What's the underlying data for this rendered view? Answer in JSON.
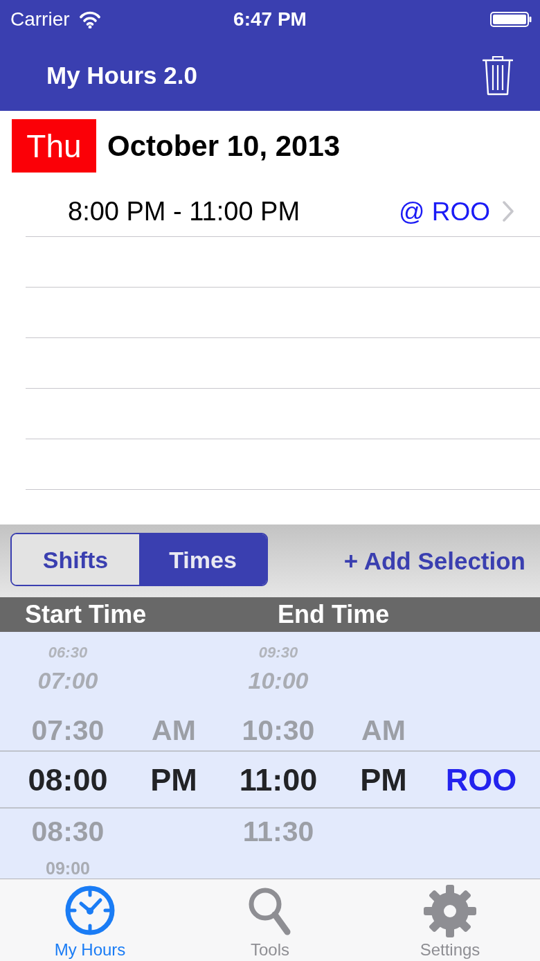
{
  "status_bar": {
    "carrier": "Carrier",
    "time": "6:47 PM"
  },
  "nav_bar": {
    "title": "My Hours 2.0"
  },
  "day": {
    "weekday": "Thu",
    "date": "October 10, 2013",
    "entries": [
      {
        "time": "8:00 PM - 11:00 PM",
        "location": "@ ROO"
      }
    ]
  },
  "toolbar": {
    "segments": [
      {
        "label": "Shifts",
        "selected": false
      },
      {
        "label": "Times",
        "selected": true
      }
    ],
    "add_button": "+ Add Selection"
  },
  "picker": {
    "headers": [
      "Start Time",
      "End Time"
    ],
    "columns": [
      {
        "kind": "time",
        "items": [
          {
            "label": "06:30",
            "selected": false
          },
          {
            "label": "07:00",
            "selected": false
          },
          {
            "label": "07:30",
            "selected": false
          },
          {
            "label": "08:00",
            "selected": true
          },
          {
            "label": "08:30",
            "selected": false
          },
          {
            "label": "09:00",
            "selected": false
          }
        ]
      },
      {
        "kind": "period",
        "items": [
          {
            "label": "AM",
            "selected": false
          },
          {
            "label": "PM",
            "selected": true
          }
        ]
      },
      {
        "kind": "time",
        "items": [
          {
            "label": "09:30",
            "selected": false
          },
          {
            "label": "10:00",
            "selected": false
          },
          {
            "label": "10:30",
            "selected": false
          },
          {
            "label": "11:00",
            "selected": true
          },
          {
            "label": "11:30",
            "selected": false
          }
        ]
      },
      {
        "kind": "period",
        "items": [
          {
            "label": "AM",
            "selected": false
          },
          {
            "label": "PM",
            "selected": true
          }
        ]
      },
      {
        "kind": "location",
        "items": [
          {
            "label": "ROO",
            "selected": true
          }
        ]
      }
    ]
  },
  "tab_bar": {
    "items": [
      {
        "label": "My Hours",
        "selected": true
      },
      {
        "label": "Tools",
        "selected": false
      },
      {
        "label": "Settings",
        "selected": false
      }
    ]
  }
}
